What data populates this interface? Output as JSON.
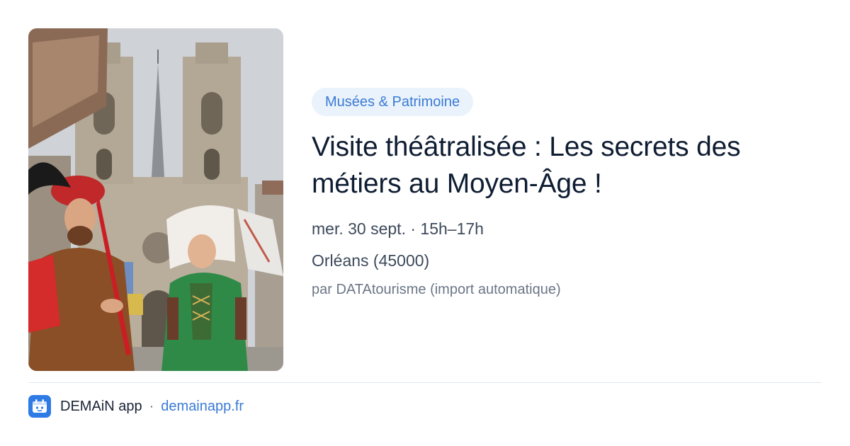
{
  "event": {
    "category": "Musées & Patrimoine",
    "title": "Visite théâtralisée : Les secrets des métiers au Moyen-Âge !",
    "date": "mer. 30 sept. · 15h–17h",
    "location": "Orléans (45000)",
    "source": "par DATAtourisme (import automatique)",
    "image": "cathedral-photo-with-costumed-actors"
  },
  "footer": {
    "app_icon": "demain-app-icon",
    "app_name": "DEMAiN app",
    "separator": "·",
    "url": "demainapp.fr"
  },
  "colors": {
    "accent": "#3a7bd5",
    "badge_bg": "#eaf2fb",
    "title": "#0f1d33",
    "text": "#3d4a5c",
    "muted": "#6b7686",
    "app_icon_bg": "#2f7be5"
  }
}
